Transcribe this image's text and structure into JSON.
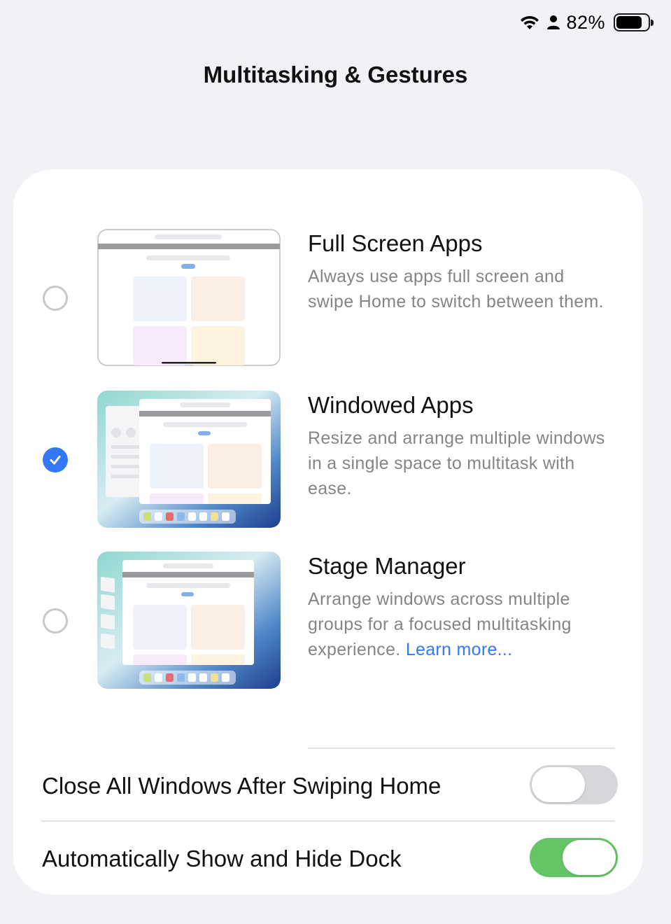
{
  "status": {
    "battery_percent": "82%",
    "battery_level": 0.82
  },
  "page": {
    "title": "Multitasking & Gestures"
  },
  "options": [
    {
      "title": "Full Screen Apps",
      "description": "Always use apps full screen and swipe Home to switch between them.",
      "selected": false
    },
    {
      "title": "Windowed Apps",
      "description": "Resize and arrange multiple windows in a single space to multitask with ease.",
      "selected": true
    },
    {
      "title": "Stage Manager",
      "description": "Arrange windows across multiple groups for a focused multitasking experience.",
      "learn_more": "Learn more...",
      "selected": false
    }
  ],
  "toggles": [
    {
      "label": "Close All Windows After Swiping Home",
      "on": false
    },
    {
      "label": "Automatically Show and Hide Dock",
      "on": true
    }
  ],
  "colors": {
    "background": "#f1f1f6",
    "accent": "#3478f6",
    "toggle_on": "#65c466",
    "toggle_off": "#d7d7db",
    "secondary_text": "#858589"
  }
}
